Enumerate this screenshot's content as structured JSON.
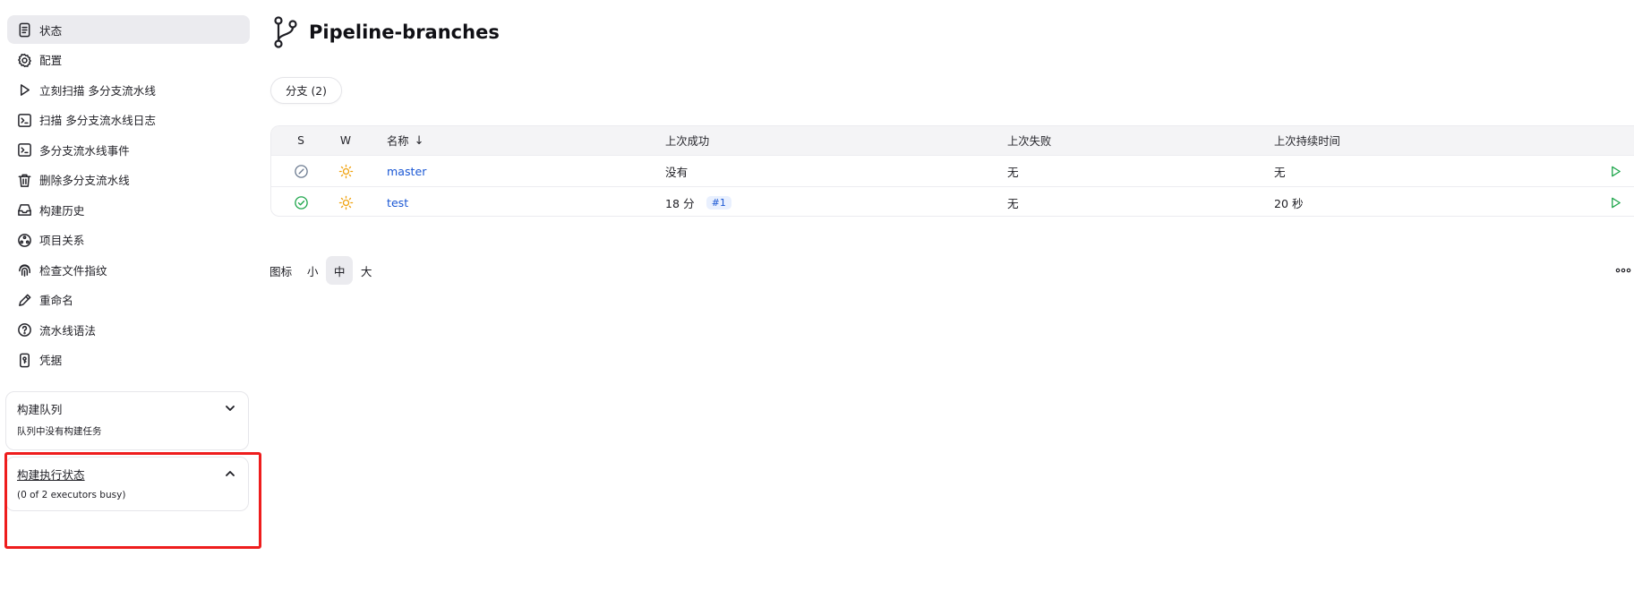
{
  "sidebar": {
    "items": [
      {
        "label": "状态",
        "icon": "document-icon",
        "active": true
      },
      {
        "label": "配置",
        "icon": "gear-icon"
      },
      {
        "label": "立刻扫描 多分支流水线",
        "icon": "play-icon"
      },
      {
        "label": "扫描 多分支流水线日志",
        "icon": "terminal-icon"
      },
      {
        "label": "多分支流水线事件",
        "icon": "terminal-icon"
      },
      {
        "label": "删除多分支流水线",
        "icon": "trash-icon"
      },
      {
        "label": "构建历史",
        "icon": "inbox-icon"
      },
      {
        "label": "项目关系",
        "icon": "relationship-icon"
      },
      {
        "label": "检查文件指纹",
        "icon": "fingerprint-icon"
      },
      {
        "label": "重命名",
        "icon": "pencil-icon"
      },
      {
        "label": "流水线语法",
        "icon": "help-icon"
      },
      {
        "label": "凭据",
        "icon": "credentials-icon"
      }
    ],
    "build_queue": {
      "title": "构建队列",
      "empty_text": "队列中没有构建任务"
    },
    "executors": {
      "title": "构建执行状态",
      "status_text": "(0 of 2 executors busy)"
    }
  },
  "header": {
    "title": "Pipeline-branches",
    "icon": "branch-icon"
  },
  "tabs": [
    {
      "label": "分支 (2)"
    }
  ],
  "table": {
    "columns": {
      "s": "S",
      "w": "W",
      "name": "名称",
      "sort_indicator": "↓",
      "last_success": "上次成功",
      "last_failure": "上次失败",
      "last_duration": "上次持续时间"
    },
    "rows": [
      {
        "name": "master",
        "status": "not-built",
        "weather": "sunny",
        "last_success": "没有",
        "build_tag": "",
        "last_failure": "无",
        "last_duration": "无"
      },
      {
        "name": "test",
        "status": "success",
        "weather": "sunny",
        "last_success": "18 分",
        "build_tag": "#1",
        "last_failure": "无",
        "last_duration": "20 秒"
      }
    ]
  },
  "icon_size": {
    "label": "图标",
    "options": [
      "小",
      "中",
      "大"
    ],
    "selected": "中"
  },
  "colors": {
    "link": "#1a57d4",
    "success": "#1ea64b",
    "weather": "#f0a312",
    "run": "#1ea64b",
    "highlight": "#ee1d1d"
  }
}
